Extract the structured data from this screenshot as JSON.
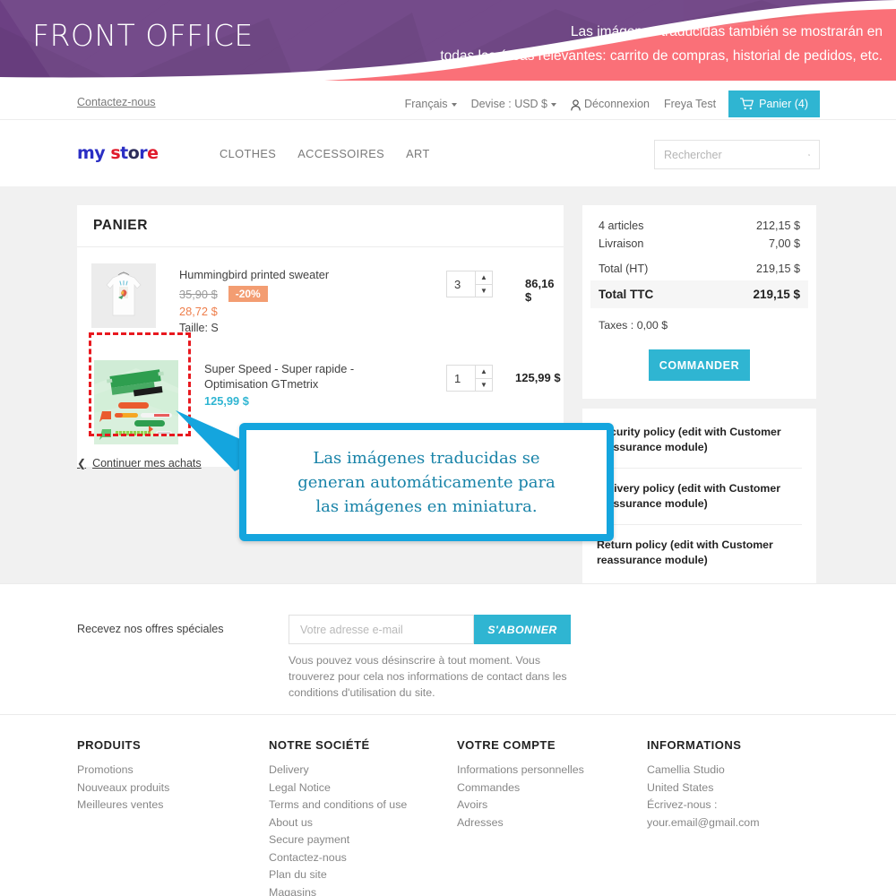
{
  "banner": {
    "title": "FRONT OFFICE",
    "note_line1": "Las imágenes traducidas también se mostrarán en",
    "note_line2": "todas las áreas relevantes: carrito de compras, historial de pedidos, etc.",
    "purple": "#6c4083",
    "pink": "#fa7078"
  },
  "topbar": {
    "contact_label": "Contactez-nous",
    "language": "Français",
    "currency": "Devise : USD $",
    "logout_label": "Déconnexion",
    "user_name": "Freya Test",
    "cart_label": "Panier (4)",
    "accent": "#2fb5d2"
  },
  "header": {
    "logo": {
      "part1": "my",
      "part2": "s",
      "part3": "t",
      "part4": "o",
      "part5": "r",
      "part6": "e"
    },
    "nav": [
      {
        "label": "CLOTHES"
      },
      {
        "label": "ACCESSOIRES"
      },
      {
        "label": "ART"
      }
    ],
    "search": {
      "placeholder": "Rechercher",
      "value": ""
    }
  },
  "cart": {
    "title": "PANIER",
    "continue_label": "Continuer mes achats",
    "items": [
      {
        "name": "Hummingbird printed sweater",
        "old_price": "35,90 $",
        "discount": "-20%",
        "new_price": "28,72 $",
        "attribute": "Taille: S",
        "qty": "3",
        "total": "86,16 $"
      },
      {
        "name": "Super Speed - Super rapide - Optimisation GTmetrix",
        "old_price": "",
        "discount": "",
        "new_price": "125,99 $",
        "attribute": "",
        "qty": "1",
        "total": "125,99 $"
      }
    ]
  },
  "summary": {
    "rows": [
      {
        "label": "4 articles",
        "value": "212,15 $"
      },
      {
        "label": "Livraison",
        "value": "7,00 $"
      },
      {
        "label": "Total (HT)",
        "value": "219,15 $"
      }
    ],
    "total_label": "Total TTC",
    "total_value": "219,15 $",
    "taxes": "Taxes : 0,00 $",
    "order_button": "COMMANDER"
  },
  "reassurance": [
    {
      "text": "Security policy (edit with Customer reassurance module)"
    },
    {
      "text": "Delivery policy (edit with Customer reassurance module)"
    },
    {
      "text": "Return policy (edit with Customer reassurance module)"
    }
  ],
  "callout": {
    "line1": "Las imágenes traducidas se",
    "line2": "generan automáticamente para",
    "line3": "las imágenes en miniatura.",
    "border_color": "#14a5de",
    "text_color": "#1883a8",
    "highlight_color": "#e8181f"
  },
  "newsletter": {
    "label": "Recevez nos offres spéciales",
    "placeholder": "Votre adresse e-mail",
    "button": "S'ABONNER",
    "note": "Vous pouvez vous désinscrire à tout moment. Vous trouverez pour cela nos informations de contact dans les conditions d'utilisation du site."
  },
  "footer": {
    "columns": [
      {
        "title": "PRODUITS",
        "links": [
          {
            "label": "Promotions"
          },
          {
            "label": "Nouveaux produits"
          },
          {
            "label": "Meilleures ventes"
          }
        ]
      },
      {
        "title": "NOTRE SOCIÉTÉ",
        "links": [
          {
            "label": "Delivery"
          },
          {
            "label": "Legal Notice"
          },
          {
            "label": "Terms and conditions of use"
          },
          {
            "label": "About us"
          },
          {
            "label": "Secure payment"
          },
          {
            "label": "Contactez-nous"
          },
          {
            "label": "Plan du site"
          },
          {
            "label": "Magasins"
          }
        ]
      },
      {
        "title": "VOTRE COMPTE",
        "links": [
          {
            "label": "Informations personnelles"
          },
          {
            "label": "Commandes"
          },
          {
            "label": "Avoirs"
          },
          {
            "label": "Adresses"
          }
        ]
      },
      {
        "title": "INFORMATIONS",
        "links": [
          {
            "label": "Camellia Studio"
          },
          {
            "label": "United States"
          },
          {
            "label": "Écrivez-nous :"
          },
          {
            "label": "your.email@gmail.com"
          }
        ]
      }
    ]
  },
  "thumbnails": {
    "product2_title": "Super Vitesse"
  }
}
